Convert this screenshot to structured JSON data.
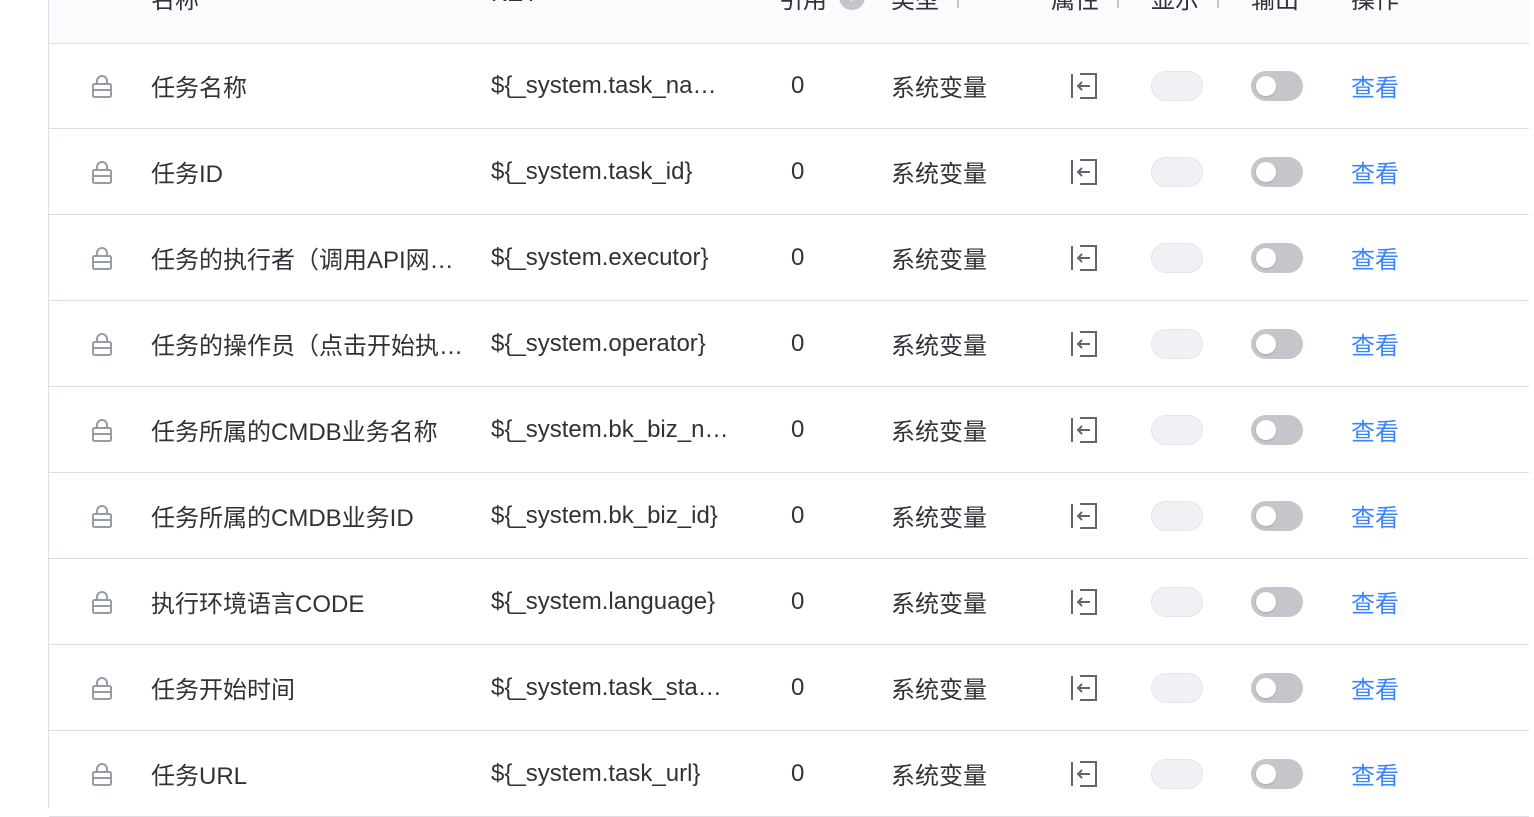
{
  "columns": {
    "name": "名称",
    "key": "KEY",
    "ref": "引用",
    "type": "类型",
    "attr": "属性",
    "show": "显示",
    "output": "输出",
    "op": "操作"
  },
  "rows": [
    {
      "name": "任务名称",
      "key": "${_system.task_na…",
      "ref": "0",
      "type": "系统变量",
      "action": "查看"
    },
    {
      "name": "任务ID",
      "key": "${_system.task_id}",
      "ref": "0",
      "type": "系统变量",
      "action": "查看"
    },
    {
      "name": "任务的执行者（调用API网…",
      "key": "${_system.executor}",
      "ref": "0",
      "type": "系统变量",
      "action": "查看"
    },
    {
      "name": "任务的操作员（点击开始执…",
      "key": "${_system.operator}",
      "ref": "0",
      "type": "系统变量",
      "action": "查看"
    },
    {
      "name": "任务所属的CMDB业务名称",
      "key": "${_system.bk_biz_n…",
      "ref": "0",
      "type": "系统变量",
      "action": "查看"
    },
    {
      "name": "任务所属的CMDB业务ID",
      "key": "${_system.bk_biz_id}",
      "ref": "0",
      "type": "系统变量",
      "action": "查看"
    },
    {
      "name": "执行环境语言CODE",
      "key": "${_system.language}",
      "ref": "0",
      "type": "系统变量",
      "action": "查看"
    },
    {
      "name": "任务开始时间",
      "key": "${_system.task_sta…",
      "ref": "0",
      "type": "系统变量",
      "action": "查看"
    },
    {
      "name": "任务URL",
      "key": "${_system.task_url}",
      "ref": "0",
      "type": "系统变量",
      "action": "查看"
    }
  ],
  "icons": {
    "lock": "lock-icon",
    "attr": "input-attribute-icon",
    "info": "info-icon"
  },
  "colors": {
    "link": "#3a84ff",
    "toggle_off": "#c4c6cc",
    "toggle_disabled": "#f0f1f5",
    "border": "#dcdee5"
  },
  "toggles": {
    "show_state": "disabled",
    "output_state": "off"
  }
}
